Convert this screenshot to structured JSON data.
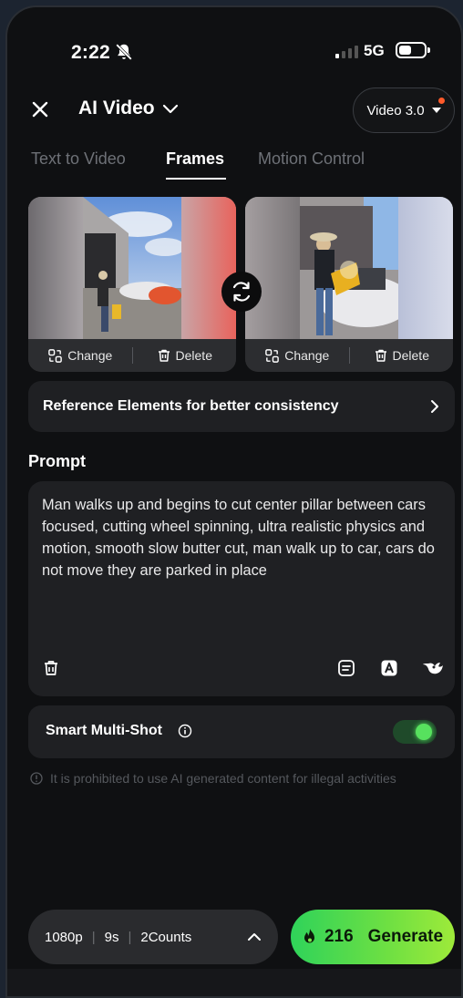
{
  "status_bar": {
    "time": "2:22",
    "network": "5G"
  },
  "header": {
    "title": "AI Video",
    "model": "Video 3.0"
  },
  "tabs": [
    {
      "label": "Text to Video",
      "active": false
    },
    {
      "label": "Frames",
      "active": true
    },
    {
      "label": "Motion Control",
      "active": false
    }
  ],
  "frames": {
    "change_label": "Change",
    "delete_label": "Delete"
  },
  "reference": {
    "label": "Reference Elements for better consistency"
  },
  "prompt": {
    "label": "Prompt",
    "text": "Man walks up and begins to cut center pillar between cars focused, cutting wheel spinning, ultra realistic physics and motion, smooth slow butter cut, man walk up to car, cars do not move they are parked in place"
  },
  "smart_multishot": {
    "label": "Smart Multi-Shot",
    "enabled": true
  },
  "warning": "It is prohibited to use AI generated content for illegal activities",
  "settings": {
    "resolution": "1080p",
    "duration": "9s",
    "counts": "2Counts"
  },
  "generate": {
    "credits": "216",
    "label": "Generate"
  },
  "colors": {
    "accent_green": "#57e15e",
    "notification_dot": "#ff5a2a"
  }
}
